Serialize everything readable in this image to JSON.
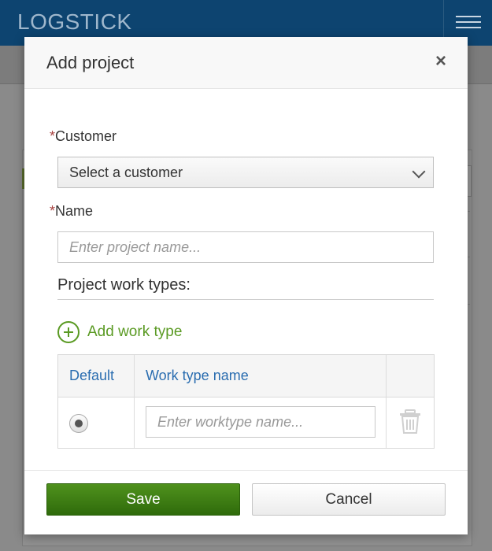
{
  "app": {
    "title": "LOGSTICK"
  },
  "modal": {
    "title": "Add project",
    "close_label": "×",
    "customer": {
      "required_mark": "*",
      "label": "Customer",
      "selected": "Select a customer"
    },
    "name": {
      "required_mark": "*",
      "label": "Name",
      "placeholder": "Enter project name..."
    },
    "work_types": {
      "section_title": "Project work types:",
      "add_label": "Add work type",
      "columns": [
        "Default",
        "Work type name"
      ],
      "rows": [
        {
          "default_selected": true,
          "placeholder": "Enter worktype name..."
        }
      ]
    },
    "footer": {
      "save_label": "Save",
      "cancel_label": "Cancel"
    }
  },
  "colors": {
    "accent_green": "#5a9a23",
    "header_blue": "#0d4470",
    "link_blue": "#2a6db0"
  },
  "icons": [
    "menu-icon",
    "close-icon",
    "chevron-down-icon",
    "plus-circle-icon",
    "radio-icon",
    "trash-icon"
  ]
}
